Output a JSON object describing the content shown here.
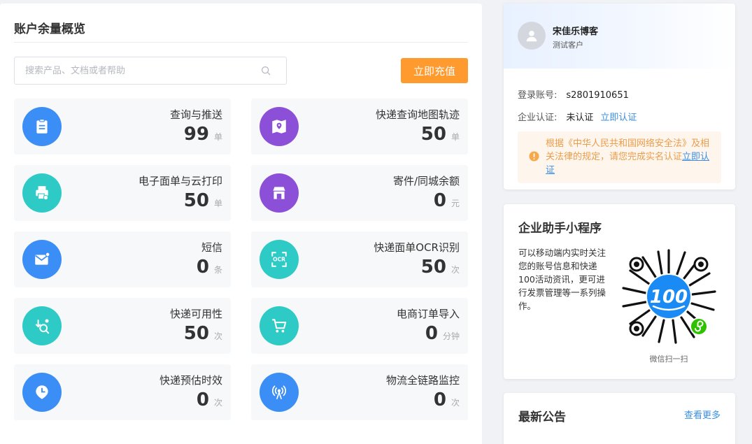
{
  "overview": {
    "title": "账户余量概览",
    "search_placeholder": "搜索产品、文档或者帮助",
    "recharge_label": "立即充值",
    "cards": [
      {
        "name": "查询与推送",
        "value": "99",
        "unit": "单",
        "icon": "clipboard-icon",
        "color": "#3a8ef6"
      },
      {
        "name": "快递查询地图轨迹",
        "value": "50",
        "unit": "单",
        "icon": "map-pin-icon",
        "color": "#8c4fd8"
      },
      {
        "name": "电子面单与云打印",
        "value": "50",
        "unit": "单",
        "icon": "printer-cloud-icon",
        "color": "#2ecbc6"
      },
      {
        "name": "寄件/同城余额",
        "value": "0",
        "unit": "元",
        "icon": "shop-icon",
        "color": "#8c4fd8"
      },
      {
        "name": "短信",
        "value": "0",
        "unit": "条",
        "icon": "message-icon",
        "color": "#3a8ef6"
      },
      {
        "name": "快递面单OCR识别",
        "value": "50",
        "unit": "次",
        "icon": "ocr-icon",
        "color": "#2ecbc6"
      },
      {
        "name": "快递可用性",
        "value": "50",
        "unit": "次",
        "icon": "search-check-icon",
        "color": "#2ecbc6"
      },
      {
        "name": "电商订单导入",
        "value": "0",
        "unit": "分钟",
        "icon": "cart-icon",
        "color": "#2ecbc6"
      },
      {
        "name": "快递预估时效",
        "value": "0",
        "unit": "次",
        "icon": "clock-pin-icon",
        "color": "#3a8ef6"
      },
      {
        "name": "物流全链路监控",
        "value": "0",
        "unit": "次",
        "icon": "antenna-icon",
        "color": "#3a8ef6"
      }
    ]
  },
  "account": {
    "name": "宋佳乐博客",
    "type": "测试客户",
    "login_label": "登录账号:",
    "login_value": "s2801910651",
    "cert_label": "企业认证:",
    "cert_value": "未认证",
    "cert_link": "立即认证",
    "warning_text": "根据《中华人民共和国网络安全法》及相关法律的规定，请您完成实名认证",
    "warning_link": "立即认证"
  },
  "mini_program": {
    "title": "企业助手小程序",
    "description": "可以移动端内实时关注您的账号信息和快递100活动资讯，更可进行发票管理等一系列操作。",
    "qr_logo_text": "100",
    "qr_caption": "微信扫一扫"
  },
  "notice": {
    "title": "最新公告",
    "more_label": "查看更多"
  },
  "colors": {
    "accent_orange": "#ff9a2e",
    "link_blue": "#3a8ee6",
    "warning_orange": "#ea9c4b"
  }
}
